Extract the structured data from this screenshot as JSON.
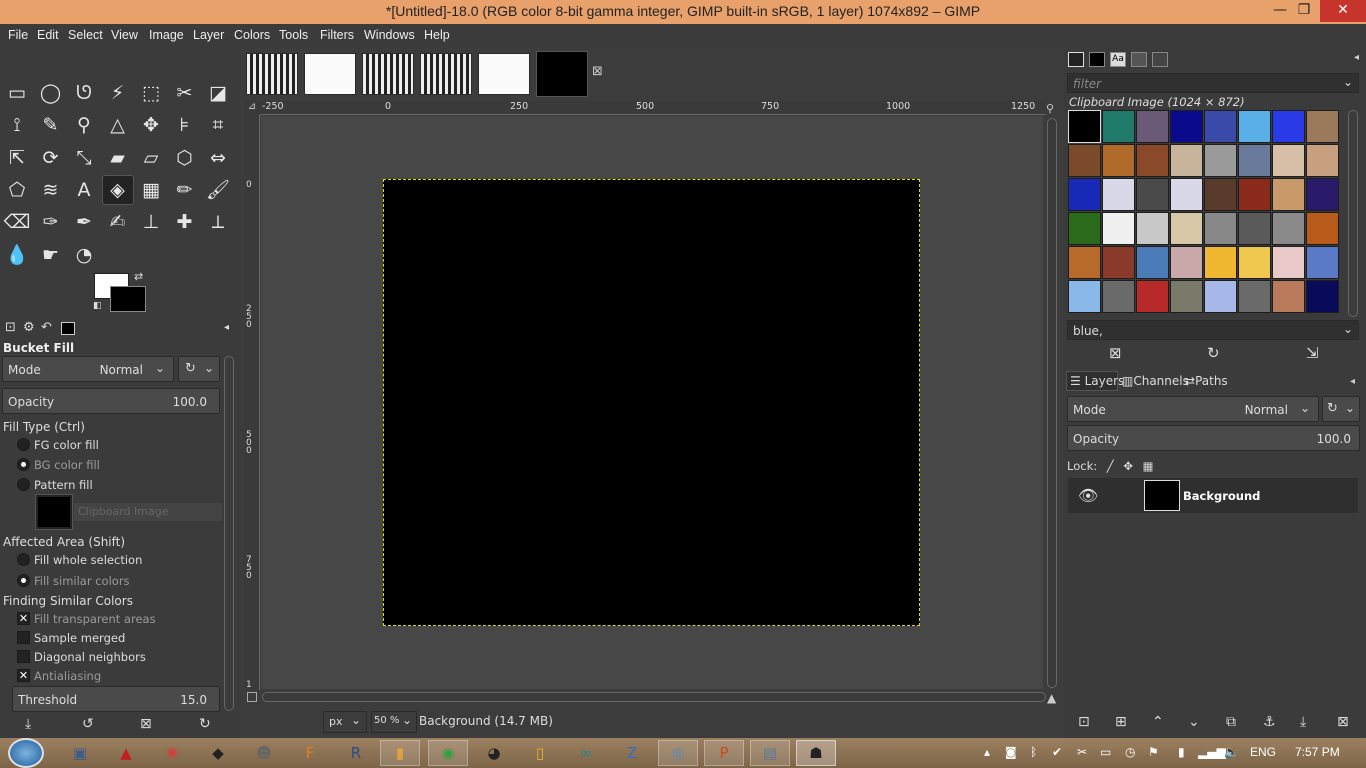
{
  "window": {
    "title": "*[Untitled]-18.0 (RGB color 8-bit gamma integer, GIMP built-in sRGB, 1 layer) 1074x892 – GIMP",
    "minimize": "—",
    "maximize": "❐",
    "close": "✕"
  },
  "menu": [
    "File",
    "Edit",
    "Select",
    "View",
    "Image",
    "Layer",
    "Colors",
    "Tools",
    "Filters",
    "Windows",
    "Help"
  ],
  "tools": {
    "icons": [
      [
        "rect-select-icon",
        "▭"
      ],
      [
        "ellipse-select-icon",
        "◯"
      ],
      [
        "free-select-icon",
        "ᘎ"
      ],
      [
        "fuzzy-select-icon",
        "⚡"
      ],
      [
        "select-by-color-icon",
        "⬚"
      ],
      [
        "scissors-select-icon",
        "✂"
      ],
      [
        "foreground-select-icon",
        "◪"
      ],
      [
        "paths-icon",
        "⟟"
      ],
      [
        "color-picker-icon",
        "✎"
      ],
      [
        "zoom-icon",
        "⚲"
      ],
      [
        "measure-icon",
        "△"
      ],
      [
        "move-icon",
        "✥"
      ],
      [
        "align-icon",
        "⊧"
      ],
      [
        "crop-icon",
        "⌗"
      ],
      [
        "unified-transform-icon",
        "⇱"
      ],
      [
        "rotate-icon",
        "⟳"
      ],
      [
        "scale-icon",
        "⤡"
      ],
      [
        "shear-icon",
        "▰"
      ],
      [
        "perspective-icon",
        "▱"
      ],
      [
        "3d-transform-icon",
        "⬡"
      ],
      [
        "flip-icon",
        "⇔"
      ],
      [
        "cage-transform-icon",
        "⬠"
      ],
      [
        "warp-transform-icon",
        "≋"
      ],
      [
        "text-icon",
        "A"
      ],
      [
        "bucket-fill-icon",
        "◈"
      ],
      [
        "gradient-icon",
        "▦"
      ],
      [
        "pencil-icon",
        "✏"
      ],
      [
        "paintbrush-icon",
        "🖌"
      ],
      [
        "eraser-icon",
        "⌫"
      ],
      [
        "airbrush-icon",
        "✑"
      ],
      [
        "ink-icon",
        "✒"
      ],
      [
        "mypaint-brush-icon",
        "✍"
      ],
      [
        "clone-icon",
        "⊥"
      ],
      [
        "heal-icon",
        "✚"
      ],
      [
        "perspective-clone-icon",
        "⟂"
      ],
      [
        "blur-icon",
        "💧"
      ],
      [
        "smudge-icon",
        "☛"
      ],
      [
        "dodge-burn-icon",
        "◔"
      ]
    ],
    "active_index": 24
  },
  "tool_options": {
    "title": "Bucket Fill",
    "mode_label": "Mode",
    "mode_value": "Normal",
    "opacity_label": "Opacity",
    "opacity_value": "100.0",
    "fill_type_label": "Fill Type  (Ctrl)",
    "fill_types": [
      {
        "label": "FG color fill",
        "on": false,
        "dim": false
      },
      {
        "label": "BG color fill",
        "on": true,
        "dim": true
      },
      {
        "label": "Pattern fill",
        "on": false,
        "dim": false
      }
    ],
    "pattern_name": "Clipboard Image",
    "affected_area_label": "Affected Area  (Shift)",
    "affected_area": [
      {
        "label": "Fill whole selection",
        "on": false,
        "dim": false
      },
      {
        "label": "Fill similar colors",
        "on": true,
        "dim": true
      }
    ],
    "similar_colors_label": "Finding Similar Colors",
    "similar_options": [
      {
        "label": "Fill transparent areas",
        "checked": true,
        "dim": true
      },
      {
        "label": "Sample merged",
        "checked": false,
        "dim": false
      },
      {
        "label": "Diagonal neighbors",
        "checked": false,
        "dim": false
      },
      {
        "label": "Antialiasing",
        "checked": true,
        "dim": true
      }
    ],
    "threshold_label": "Threshold",
    "threshold_value": "15.0"
  },
  "rulers": {
    "h_labels": [
      "-250",
      "0",
      "250",
      "500",
      "750",
      "1000",
      "1250"
    ],
    "v_labels": [
      "0",
      "250",
      "500",
      "750",
      "1"
    ]
  },
  "status": {
    "unit": "px",
    "zoom": "50 %",
    "message": "Background (14.7 MB)"
  },
  "patterns": {
    "filter_placeholder": "filter",
    "selected_name": "Clipboard Image (1024 × 872)",
    "tag_value": "blue,",
    "colors": [
      "#000000",
      "#1f7a6a",
      "#6a5a78",
      "#0a0a8c",
      "#3a4aa8",
      "#5ab0e6",
      "#2a3ae6",
      "#9a7a5a",
      "#7a4a2a",
      "#b06a2a",
      "#8a4a2a",
      "#c8b49a",
      "#9a9a9a",
      "#6a7a9a",
      "#d8c0a8",
      "#c8a080",
      "#1a2ab8",
      "#d8d8e8",
      "#4a4a4a",
      "#d8d8e8",
      "#5a3a2a",
      "#8a2a1a",
      "#c89a6a",
      "#2a1a6a",
      "#2a6a1a",
      "#f0f0f0",
      "#c8c8c8",
      "#d8c8a8",
      "#888888",
      "#5a5a5a",
      "#8a8a8a",
      "#b85a1a",
      "#b86a2a",
      "#8a3a2a",
      "#4a7ab8",
      "#c8a8a8",
      "#f0b830",
      "#f0c850",
      "#e8c8c8",
      "#5a7ac8",
      "#8ab8e8",
      "#6a6a6a",
      "#b82a2a",
      "#7a7a6a",
      "#a8b8e8",
      "#6a6a6a",
      "#b87a5a",
      "#0a0a5a"
    ]
  },
  "layers": {
    "tabs": [
      "Layers",
      "Channels",
      "Paths"
    ],
    "mode_label": "Mode",
    "mode_value": "Normal",
    "opacity_label": "Opacity",
    "opacity_value": "100.0",
    "lock_label": "Lock:",
    "items": [
      {
        "name": "Background"
      }
    ]
  },
  "taskbar": {
    "apps": [
      {
        "name": "app-icon-1",
        "glyph": "▣",
        "color": "#3a5a8a",
        "state": "none"
      },
      {
        "name": "app-icon-2",
        "glyph": "▲",
        "color": "#c02020",
        "state": "none"
      },
      {
        "name": "app-icon-3",
        "glyph": "✺",
        "color": "#d04040",
        "state": "none"
      },
      {
        "name": "app-icon-4",
        "glyph": "◆",
        "color": "#222222",
        "state": "none"
      },
      {
        "name": "gimp-icon",
        "glyph": "☻",
        "color": "#666666",
        "state": "none"
      },
      {
        "name": "app-icon-6",
        "glyph": "F",
        "color": "#e08020",
        "state": "none"
      },
      {
        "name": "app-icon-7",
        "glyph": "R",
        "color": "#2a4a8a",
        "state": "none"
      },
      {
        "name": "app-icon-8",
        "glyph": "▮",
        "color": "#e0a040",
        "state": "open"
      },
      {
        "name": "chrome-icon",
        "glyph": "◉",
        "color": "#30a040",
        "state": "open"
      },
      {
        "name": "app-icon-10",
        "glyph": "◕",
        "color": "#222222",
        "state": "none"
      },
      {
        "name": "app-icon-11",
        "glyph": "▯",
        "color": "#f0b020",
        "state": "none"
      },
      {
        "name": "arduino-icon",
        "glyph": "∞",
        "color": "#1a8a8a",
        "state": "none"
      },
      {
        "name": "app-icon-13",
        "glyph": "Z",
        "color": "#3a6ac8",
        "state": "none"
      },
      {
        "name": "app-icon-14",
        "glyph": "◎",
        "color": "#4a8ac8",
        "state": "open"
      },
      {
        "name": "powerpoint-icon",
        "glyph": "P",
        "color": "#c84a1a",
        "state": "open"
      },
      {
        "name": "app-icon-16",
        "glyph": "▤",
        "color": "#5a7a9a",
        "state": "open"
      },
      {
        "name": "gimp-taskbar-icon",
        "glyph": "☗",
        "color": "#222222",
        "state": "current"
      }
    ],
    "language": "ENG",
    "time": "7:57 PM"
  }
}
